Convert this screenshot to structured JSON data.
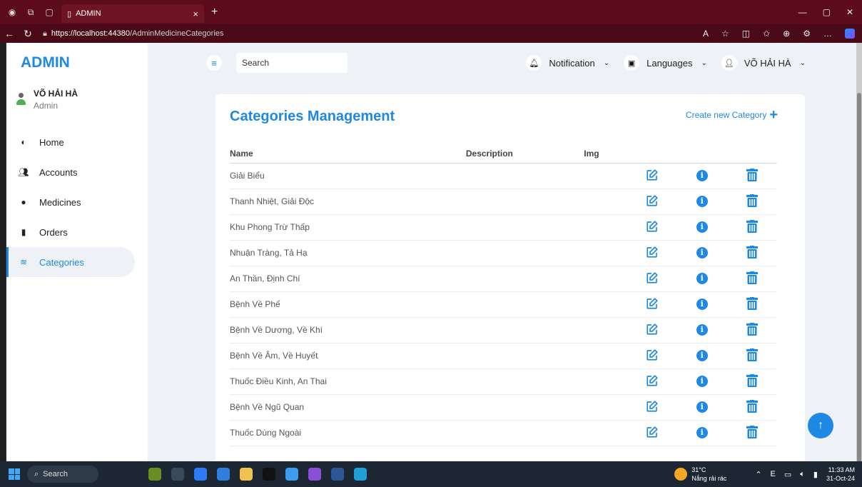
{
  "browser": {
    "tab_title": "ADMIN",
    "tab_close": "×",
    "new_tab": "+",
    "url_host": "https://localhost:44380",
    "url_path": "/AdminMedicineCategories"
  },
  "sidebar": {
    "brand": "ADMIN",
    "user_name": "VÕ HẢI HÀ",
    "user_role": "Admin",
    "items": [
      {
        "label": "Home",
        "icon": "gauge-icon"
      },
      {
        "label": "Accounts",
        "icon": "users-icon"
      },
      {
        "label": "Medicines",
        "icon": "pills-icon"
      },
      {
        "label": "Orders",
        "icon": "document-icon"
      },
      {
        "label": "Categories",
        "icon": "layers-icon",
        "active": true
      }
    ]
  },
  "header": {
    "search_placeholder": "Search",
    "notification_label": "Notification",
    "languages_label": "Languages",
    "user_label": "VÕ HẢI HÀ"
  },
  "main": {
    "title": "Categories Management",
    "create_label": "Create new Category",
    "columns": [
      "Name",
      "Description",
      "Img"
    ],
    "rows": [
      {
        "name": "Giải Biểu"
      },
      {
        "name": "Thanh Nhiệt, Giải Độc"
      },
      {
        "name": "Khu Phong Trừ Thấp"
      },
      {
        "name": "Nhuận Tràng, Tả Hạ"
      },
      {
        "name": "An Thần, Định Chí"
      },
      {
        "name": "Bệnh Về Phế"
      },
      {
        "name": "Bệnh Về Dương, Về Khí"
      },
      {
        "name": "Bệnh Về Âm, Về Huyết"
      },
      {
        "name": "Thuốc Điều Kinh, An Thai"
      },
      {
        "name": "Bệnh Về Ngũ Quan"
      },
      {
        "name": "Thuốc Dùng Ngoài"
      }
    ]
  },
  "taskbar": {
    "search_label": "Search",
    "temperature": "31°C",
    "weather": "Nắng rải rác",
    "time": "11:33 AM",
    "date": "31-Oct-24"
  },
  "colors": {
    "accent": "#1e88e5",
    "titlebar": "#5c0b1a",
    "page_bg": "#eef1f5"
  }
}
